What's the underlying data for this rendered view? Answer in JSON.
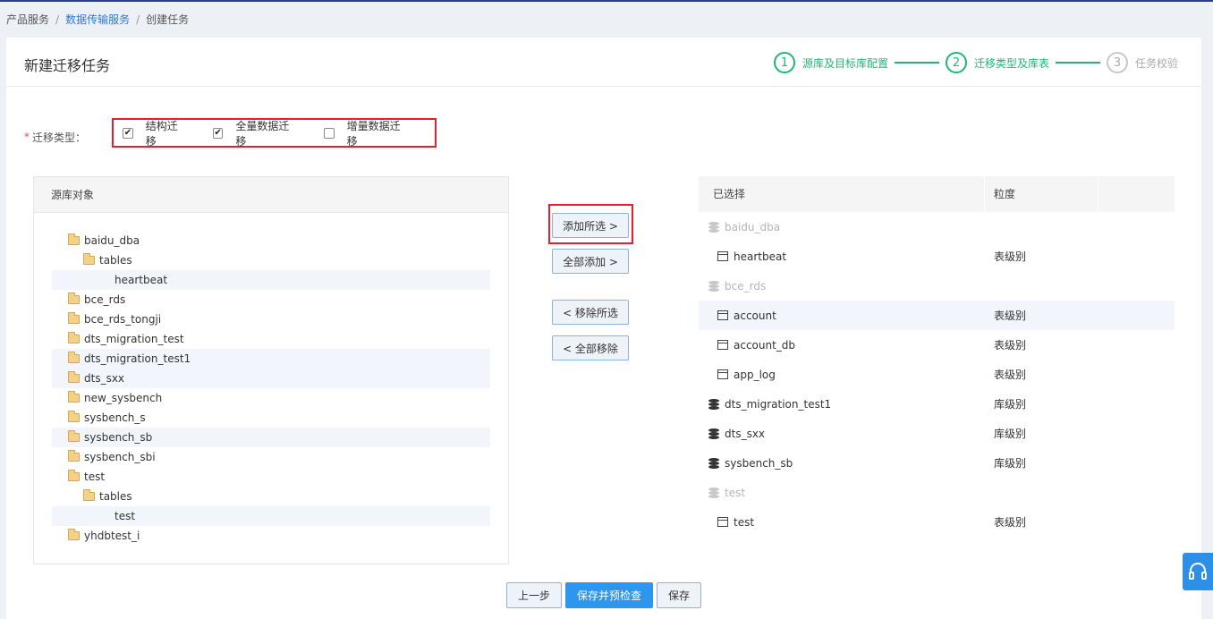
{
  "breadcrumb": {
    "items": [
      "产品服务",
      "数据传输服务",
      "创建任务"
    ],
    "sep": "/"
  },
  "header": {
    "title": "新建迁移任务",
    "steps": [
      {
        "num": "1",
        "label": "源库及目标库配置",
        "state": "done"
      },
      {
        "num": "2",
        "label": "迁移类型及库表",
        "state": "active"
      },
      {
        "num": "3",
        "label": "任务校验",
        "state": "pending"
      }
    ]
  },
  "migration_type": {
    "required_mark": "*",
    "label": "迁移类型：",
    "options": [
      {
        "label": "结构迁移",
        "checked": true
      },
      {
        "label": "全量数据迁移",
        "checked": true
      },
      {
        "label": "增量数据迁移",
        "checked": false
      }
    ]
  },
  "source_panel": {
    "title": "源库对象",
    "tree": [
      {
        "label": "baidu_dba",
        "level": 0,
        "icon": "folder-open-icon"
      },
      {
        "label": "tables",
        "level": 1,
        "icon": "folder-open-icon"
      },
      {
        "label": "heartbeat",
        "level": 2,
        "icon": "",
        "highlight": true
      },
      {
        "label": "bce_rds",
        "level": 0,
        "icon": "folder-icon"
      },
      {
        "label": "bce_rds_tongji",
        "level": 0,
        "icon": "folder-icon"
      },
      {
        "label": "dts_migration_test",
        "level": 0,
        "icon": "folder-icon"
      },
      {
        "label": "dts_migration_test1",
        "level": 0,
        "icon": "folder-icon",
        "highlight": true
      },
      {
        "label": "dts_sxx",
        "level": 0,
        "icon": "folder-icon",
        "highlight": true
      },
      {
        "label": "new_sysbench",
        "level": 0,
        "icon": "folder-icon"
      },
      {
        "label": "sysbench_s",
        "level": 0,
        "icon": "folder-icon"
      },
      {
        "label": "sysbench_sb",
        "level": 0,
        "icon": "folder-icon",
        "highlight": true
      },
      {
        "label": "sysbench_sbi",
        "level": 0,
        "icon": "folder-icon"
      },
      {
        "label": "test",
        "level": 0,
        "icon": "folder-open-icon"
      },
      {
        "label": "tables",
        "level": 1,
        "icon": "folder-open-icon"
      },
      {
        "label": "test",
        "level": 2,
        "icon": "",
        "highlight": true
      },
      {
        "label": "yhdbtest_i",
        "level": 0,
        "icon": "folder-icon"
      }
    ]
  },
  "transfer_buttons": {
    "add_selected": "添加所选 >",
    "add_all": "全部添加 >",
    "remove_selected": "< 移除所选",
    "remove_all": "< 全部移除"
  },
  "selected_panel": {
    "col_name": "已选择",
    "col_granularity": "粒度",
    "rows": [
      {
        "name": "baidu_dba",
        "type": "db",
        "granularity": "",
        "muted": true,
        "indent": false
      },
      {
        "name": "heartbeat",
        "type": "table",
        "granularity": "表级别",
        "muted": false,
        "indent": true
      },
      {
        "name": "bce_rds",
        "type": "db",
        "granularity": "",
        "muted": true,
        "indent": false
      },
      {
        "name": "account",
        "type": "table",
        "granularity": "表级别",
        "muted": false,
        "indent": true,
        "highlight": true
      },
      {
        "name": "account_db",
        "type": "table",
        "granularity": "表级别",
        "muted": false,
        "indent": true
      },
      {
        "name": "app_log",
        "type": "table",
        "granularity": "表级别",
        "muted": false,
        "indent": true
      },
      {
        "name": "dts_migration_test1",
        "type": "db",
        "granularity": "库级别",
        "muted": false,
        "indent": false
      },
      {
        "name": "dts_sxx",
        "type": "db",
        "granularity": "库级别",
        "muted": false,
        "indent": false
      },
      {
        "name": "sysbench_sb",
        "type": "db",
        "granularity": "库级别",
        "muted": false,
        "indent": false
      },
      {
        "name": "test",
        "type": "db",
        "granularity": "",
        "muted": true,
        "indent": false
      },
      {
        "name": "test",
        "type": "table",
        "granularity": "表级别",
        "muted": false,
        "indent": true
      }
    ]
  },
  "footer": {
    "prev": "上一步",
    "save_check": "保存并预检查",
    "save": "保存"
  },
  "colors": {
    "accent": "#2d97f0",
    "step_done": "#22b573",
    "highlight_box": "#e5202e",
    "delete_icon": "#3a8ee6"
  }
}
